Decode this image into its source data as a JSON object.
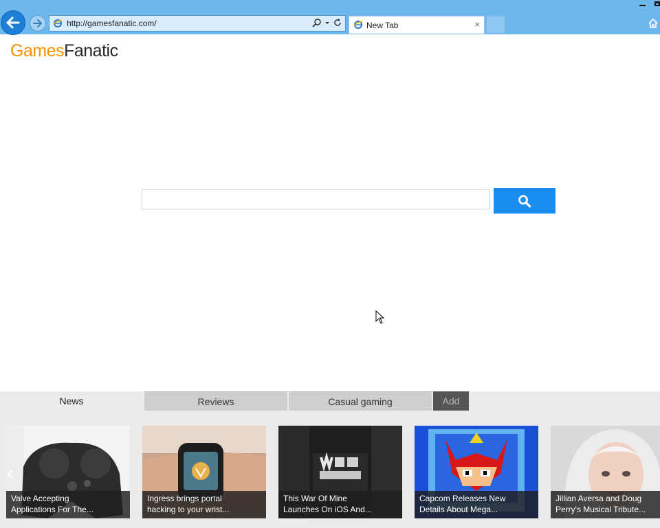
{
  "browser": {
    "address": "http://gamesfanatic.com/",
    "tab_title": "New Tab",
    "tab_close": "×"
  },
  "logo": {
    "part1": "Games",
    "part2": "Fanatic"
  },
  "search": {
    "placeholder": ""
  },
  "categories": {
    "tabs": [
      {
        "label": "News",
        "active": true
      },
      {
        "label": "Reviews",
        "active": false
      },
      {
        "label": "Casual gaming",
        "active": false
      }
    ],
    "add_label": "Add"
  },
  "carousel": {
    "prev_glyph": "‹"
  },
  "news": [
    {
      "line1": "Valve Accepting",
      "line2": "Applications For The..."
    },
    {
      "line1": "Ingress brings portal",
      "line2": "hacking to your wrist..."
    },
    {
      "line1": "This War Of Mine",
      "line2": "Launches On iOS And..."
    },
    {
      "line1": "Capcom Releases New",
      "line2": "Details About Mega..."
    },
    {
      "line1": "Jillian Aversa and Doug",
      "line2": "Perry's Musical Tribute..."
    }
  ],
  "colors": {
    "chrome": "#6cb8ee",
    "accent_orange": "#f39200",
    "search_blue": "#1a8cf0"
  }
}
